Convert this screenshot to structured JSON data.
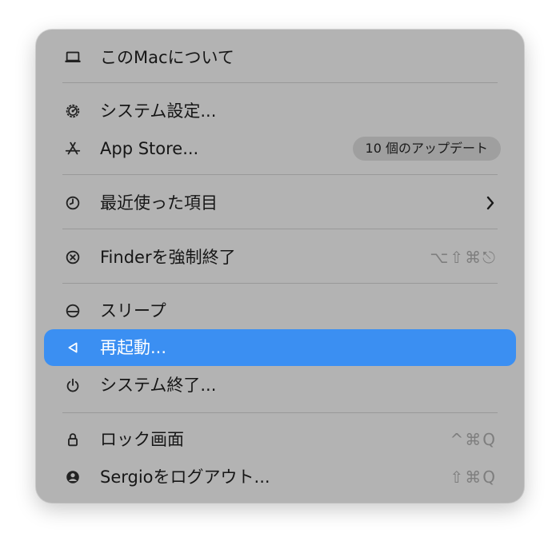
{
  "menu": {
    "items": [
      {
        "label": "このMacについて",
        "icon": "laptop-icon"
      },
      {
        "label": "システム設定...",
        "icon": "gear-icon"
      },
      {
        "label": "App Store...",
        "icon": "app-store-icon",
        "badge": "10 個のアップデート"
      },
      {
        "label": "最近使った項目",
        "icon": "clock-icon",
        "submenu_indicator": "chevron-right-icon"
      },
      {
        "label": "Finderを強制終了",
        "icon": "force-quit-icon",
        "shortcut": "⌥⇧⌘⎋"
      },
      {
        "label": "スリープ",
        "icon": "sleep-icon"
      },
      {
        "label": "再起動...",
        "icon": "restart-icon",
        "selected": true
      },
      {
        "label": "システム終了...",
        "icon": "power-icon"
      },
      {
        "label": "ロック画面",
        "icon": "lock-icon",
        "shortcut": "^⌘Q"
      },
      {
        "label": "Sergioをログアウト...",
        "icon": "user-icon",
        "shortcut": "⇧⌘Q"
      }
    ]
  },
  "colors": {
    "menu_background": "#b3b3b3",
    "selection": "#3b8ff2",
    "text": "#161616",
    "shortcut_text": "#7e7e7e",
    "badge_background": "#9f9f9f"
  }
}
